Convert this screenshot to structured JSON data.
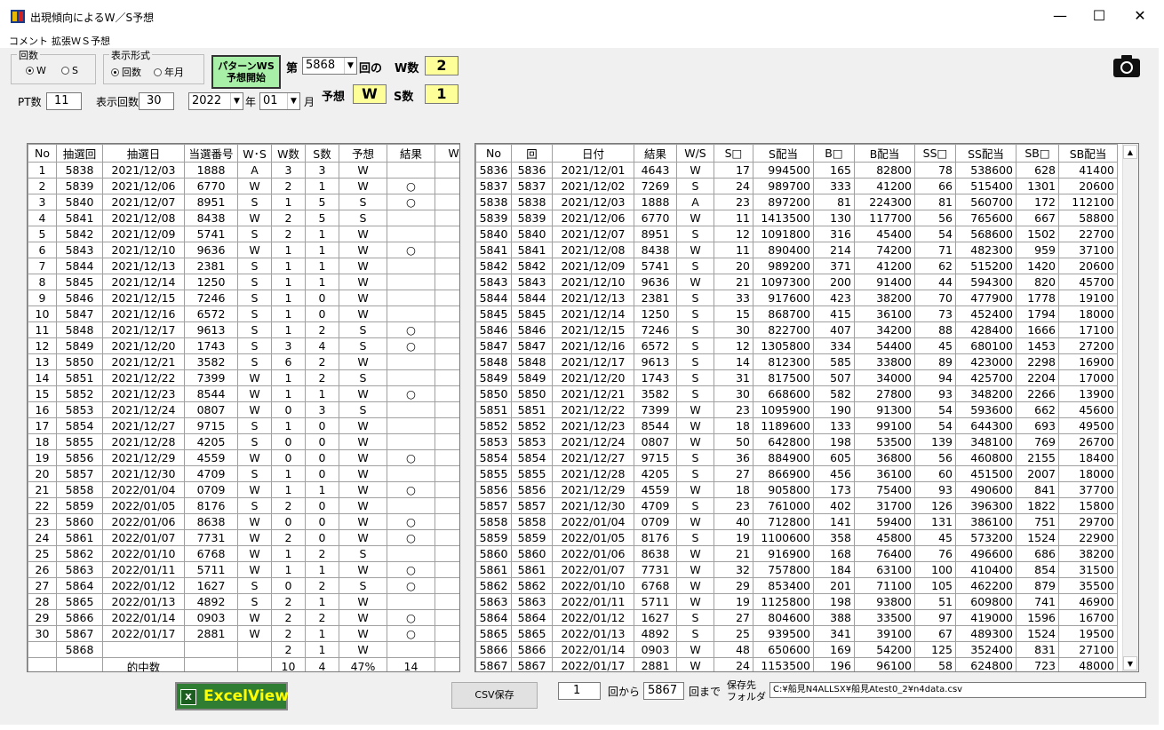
{
  "window": {
    "title": "出現傾向によるW／S予想",
    "minimize": "—",
    "maximize": "☐",
    "close": "✕"
  },
  "menu": [
    "コメント",
    "拡張ＷＳ予想"
  ],
  "controls": {
    "kaisu_group": "回数",
    "radio_w": "W",
    "radio_s": "S",
    "display_group": "表示形式",
    "radio_kaisu": "回数",
    "radio_nengetsu": "年月",
    "pattern_button_line1": "パターンWS",
    "pattern_button_line2": "予想開始",
    "dai": "第",
    "round_value": "5868",
    "kai_no": "回の",
    "w_count_label": "W数",
    "w_count_value": "2",
    "yosou_label": "予想",
    "yosou_value": "W",
    "s_count_label": "S数",
    "s_count_value": "1",
    "pt_label": "PT数",
    "pt_value": "11",
    "display_count_label": "表示回数",
    "display_count_value": "30",
    "year_value": "2022",
    "year_label": "年",
    "month_value": "01",
    "month_label": "月"
  },
  "left_table": {
    "headers": [
      "No",
      "抽選回",
      "抽選日",
      "当選番号",
      "W･S",
      "W数",
      "S数",
      "予想",
      "結果",
      "W"
    ],
    "rows": [
      [
        "1",
        "5838",
        "2021/12/03",
        "1888",
        "A",
        "3",
        "3",
        "W",
        ""
      ],
      [
        "2",
        "5839",
        "2021/12/06",
        "6770",
        "W",
        "2",
        "1",
        "W",
        "○"
      ],
      [
        "3",
        "5840",
        "2021/12/07",
        "8951",
        "S",
        "1",
        "5",
        "S",
        "○"
      ],
      [
        "4",
        "5841",
        "2021/12/08",
        "8438",
        "W",
        "2",
        "5",
        "S",
        ""
      ],
      [
        "5",
        "5842",
        "2021/12/09",
        "5741",
        "S",
        "2",
        "1",
        "W",
        ""
      ],
      [
        "6",
        "5843",
        "2021/12/10",
        "9636",
        "W",
        "1",
        "1",
        "W",
        "○"
      ],
      [
        "7",
        "5844",
        "2021/12/13",
        "2381",
        "S",
        "1",
        "1",
        "W",
        ""
      ],
      [
        "8",
        "5845",
        "2021/12/14",
        "1250",
        "S",
        "1",
        "1",
        "W",
        ""
      ],
      [
        "9",
        "5846",
        "2021/12/15",
        "7246",
        "S",
        "1",
        "0",
        "W",
        ""
      ],
      [
        "10",
        "5847",
        "2021/12/16",
        "6572",
        "S",
        "1",
        "0",
        "W",
        ""
      ],
      [
        "11",
        "5848",
        "2021/12/17",
        "9613",
        "S",
        "1",
        "2",
        "S",
        "○"
      ],
      [
        "12",
        "5849",
        "2021/12/20",
        "1743",
        "S",
        "3",
        "4",
        "S",
        "○"
      ],
      [
        "13",
        "5850",
        "2021/12/21",
        "3582",
        "S",
        "6",
        "2",
        "W",
        ""
      ],
      [
        "14",
        "5851",
        "2021/12/22",
        "7399",
        "W",
        "1",
        "2",
        "S",
        ""
      ],
      [
        "15",
        "5852",
        "2021/12/23",
        "8544",
        "W",
        "1",
        "1",
        "W",
        "○"
      ],
      [
        "16",
        "5853",
        "2021/12/24",
        "0807",
        "W",
        "0",
        "3",
        "S",
        ""
      ],
      [
        "17",
        "5854",
        "2021/12/27",
        "9715",
        "S",
        "1",
        "0",
        "W",
        ""
      ],
      [
        "18",
        "5855",
        "2021/12/28",
        "4205",
        "S",
        "0",
        "0",
        "W",
        ""
      ],
      [
        "19",
        "5856",
        "2021/12/29",
        "4559",
        "W",
        "0",
        "0",
        "W",
        "○"
      ],
      [
        "20",
        "5857",
        "2021/12/30",
        "4709",
        "S",
        "1",
        "0",
        "W",
        ""
      ],
      [
        "21",
        "5858",
        "2022/01/04",
        "0709",
        "W",
        "1",
        "1",
        "W",
        "○"
      ],
      [
        "22",
        "5859",
        "2022/01/05",
        "8176",
        "S",
        "2",
        "0",
        "W",
        ""
      ],
      [
        "23",
        "5860",
        "2022/01/06",
        "8638",
        "W",
        "0",
        "0",
        "W",
        "○"
      ],
      [
        "24",
        "5861",
        "2022/01/07",
        "7731",
        "W",
        "2",
        "0",
        "W",
        "○"
      ],
      [
        "25",
        "5862",
        "2022/01/10",
        "6768",
        "W",
        "1",
        "2",
        "S",
        ""
      ],
      [
        "26",
        "5863",
        "2022/01/11",
        "5711",
        "W",
        "1",
        "1",
        "W",
        "○"
      ],
      [
        "27",
        "5864",
        "2022/01/12",
        "1627",
        "S",
        "0",
        "2",
        "S",
        "○"
      ],
      [
        "28",
        "5865",
        "2022/01/13",
        "4892",
        "S",
        "2",
        "1",
        "W",
        ""
      ],
      [
        "29",
        "5866",
        "2022/01/14",
        "0903",
        "W",
        "2",
        "2",
        "W",
        "○"
      ],
      [
        "30",
        "5867",
        "2022/01/17",
        "2881",
        "W",
        "2",
        "1",
        "W",
        "○"
      ],
      [
        "",
        "5868",
        "",
        "",
        "",
        "2",
        "1",
        "W",
        ""
      ]
    ],
    "summary": {
      "label": "的中数",
      "w": "10",
      "s": "4",
      "pct": "47%",
      "hits": "14"
    }
  },
  "right_table": {
    "headers": [
      "No",
      "回",
      "日付",
      "結果",
      "W/S",
      "S□",
      "S配当",
      "B□",
      "B配当",
      "SS□",
      "SS配当",
      "SB□",
      "SB配当"
    ],
    "rows": [
      [
        "5836",
        "5836",
        "2021/12/01",
        "4643",
        "W",
        "17",
        "994500",
        "165",
        "82800",
        "78",
        "538600",
        "628",
        "41400"
      ],
      [
        "5837",
        "5837",
        "2021/12/02",
        "7269",
        "S",
        "24",
        "989700",
        "333",
        "41200",
        "66",
        "515400",
        "1301",
        "20600"
      ],
      [
        "5838",
        "5838",
        "2021/12/03",
        "1888",
        "A",
        "23",
        "897200",
        "81",
        "224300",
        "81",
        "560700",
        "172",
        "112100"
      ],
      [
        "5839",
        "5839",
        "2021/12/06",
        "6770",
        "W",
        "11",
        "1413500",
        "130",
        "117700",
        "56",
        "765600",
        "667",
        "58800"
      ],
      [
        "5840",
        "5840",
        "2021/12/07",
        "8951",
        "S",
        "12",
        "1091800",
        "316",
        "45400",
        "54",
        "568600",
        "1502",
        "22700"
      ],
      [
        "5841",
        "5841",
        "2021/12/08",
        "8438",
        "W",
        "11",
        "890400",
        "214",
        "74200",
        "71",
        "482300",
        "959",
        "37100"
      ],
      [
        "5842",
        "5842",
        "2021/12/09",
        "5741",
        "S",
        "20",
        "989200",
        "371",
        "41200",
        "62",
        "515200",
        "1420",
        "20600"
      ],
      [
        "5843",
        "5843",
        "2021/12/10",
        "9636",
        "W",
        "21",
        "1097300",
        "200",
        "91400",
        "44",
        "594300",
        "820",
        "45700"
      ],
      [
        "5844",
        "5844",
        "2021/12/13",
        "2381",
        "S",
        "33",
        "917600",
        "423",
        "38200",
        "70",
        "477900",
        "1778",
        "19100"
      ],
      [
        "5845",
        "5845",
        "2021/12/14",
        "1250",
        "S",
        "15",
        "868700",
        "415",
        "36100",
        "73",
        "452400",
        "1794",
        "18000"
      ],
      [
        "5846",
        "5846",
        "2021/12/15",
        "7246",
        "S",
        "30",
        "822700",
        "407",
        "34200",
        "88",
        "428400",
        "1666",
        "17100"
      ],
      [
        "5847",
        "5847",
        "2021/12/16",
        "6572",
        "S",
        "12",
        "1305800",
        "334",
        "54400",
        "45",
        "680100",
        "1453",
        "27200"
      ],
      [
        "5848",
        "5848",
        "2021/12/17",
        "9613",
        "S",
        "14",
        "812300",
        "585",
        "33800",
        "89",
        "423000",
        "2298",
        "16900"
      ],
      [
        "5849",
        "5849",
        "2021/12/20",
        "1743",
        "S",
        "31",
        "817500",
        "507",
        "34000",
        "94",
        "425700",
        "2204",
        "17000"
      ],
      [
        "5850",
        "5850",
        "2021/12/21",
        "3582",
        "S",
        "30",
        "668600",
        "582",
        "27800",
        "93",
        "348200",
        "2266",
        "13900"
      ],
      [
        "5851",
        "5851",
        "2021/12/22",
        "7399",
        "W",
        "23",
        "1095900",
        "190",
        "91300",
        "54",
        "593600",
        "662",
        "45600"
      ],
      [
        "5852",
        "5852",
        "2021/12/23",
        "8544",
        "W",
        "18",
        "1189600",
        "133",
        "99100",
        "54",
        "644300",
        "693",
        "49500"
      ],
      [
        "5853",
        "5853",
        "2021/12/24",
        "0807",
        "W",
        "50",
        "642800",
        "198",
        "53500",
        "139",
        "348100",
        "769",
        "26700"
      ],
      [
        "5854",
        "5854",
        "2021/12/27",
        "9715",
        "S",
        "36",
        "884900",
        "605",
        "36800",
        "56",
        "460800",
        "2155",
        "18400"
      ],
      [
        "5855",
        "5855",
        "2021/12/28",
        "4205",
        "S",
        "27",
        "866900",
        "456",
        "36100",
        "60",
        "451500",
        "2007",
        "18000"
      ],
      [
        "5856",
        "5856",
        "2021/12/29",
        "4559",
        "W",
        "18",
        "905800",
        "173",
        "75400",
        "93",
        "490600",
        "841",
        "37700"
      ],
      [
        "5857",
        "5857",
        "2021/12/30",
        "4709",
        "S",
        "23",
        "761000",
        "402",
        "31700",
        "126",
        "396300",
        "1822",
        "15800"
      ],
      [
        "5858",
        "5858",
        "2022/01/04",
        "0709",
        "W",
        "40",
        "712800",
        "141",
        "59400",
        "131",
        "386100",
        "751",
        "29700"
      ],
      [
        "5859",
        "5859",
        "2022/01/05",
        "8176",
        "S",
        "19",
        "1100600",
        "358",
        "45800",
        "45",
        "573200",
        "1524",
        "22900"
      ],
      [
        "5860",
        "5860",
        "2022/01/06",
        "8638",
        "W",
        "21",
        "916900",
        "168",
        "76400",
        "76",
        "496600",
        "686",
        "38200"
      ],
      [
        "5861",
        "5861",
        "2022/01/07",
        "7731",
        "W",
        "32",
        "757800",
        "184",
        "63100",
        "100",
        "410400",
        "854",
        "31500"
      ],
      [
        "5862",
        "5862",
        "2022/01/10",
        "6768",
        "W",
        "29",
        "853400",
        "201",
        "71100",
        "105",
        "462200",
        "879",
        "35500"
      ],
      [
        "5863",
        "5863",
        "2022/01/11",
        "5711",
        "W",
        "19",
        "1125800",
        "198",
        "93800",
        "51",
        "609800",
        "741",
        "46900"
      ],
      [
        "5864",
        "5864",
        "2022/01/12",
        "1627",
        "S",
        "27",
        "804600",
        "388",
        "33500",
        "97",
        "419000",
        "1596",
        "16700"
      ],
      [
        "5865",
        "5865",
        "2022/01/13",
        "4892",
        "S",
        "25",
        "939500",
        "341",
        "39100",
        "67",
        "489300",
        "1524",
        "19500"
      ],
      [
        "5866",
        "5866",
        "2022/01/14",
        "0903",
        "W",
        "48",
        "650600",
        "169",
        "54200",
        "125",
        "352400",
        "831",
        "27100"
      ],
      [
        "5867",
        "5867",
        "2022/01/17",
        "2881",
        "W",
        "24",
        "1153500",
        "196",
        "96100",
        "58",
        "624800",
        "723",
        "48000"
      ]
    ]
  },
  "bottom": {
    "excel_label": "ExcelView",
    "excel_badge": "X",
    "csv_label": "CSV保存",
    "from_value": "1",
    "from_label": "回から",
    "to_value": "5867",
    "to_label": "回まで",
    "save_label_line1": "保存先",
    "save_label_line2": "フォルダ",
    "save_path": "C:¥船見N4ALLSX¥船見Atest0_2¥n4data.csv"
  }
}
